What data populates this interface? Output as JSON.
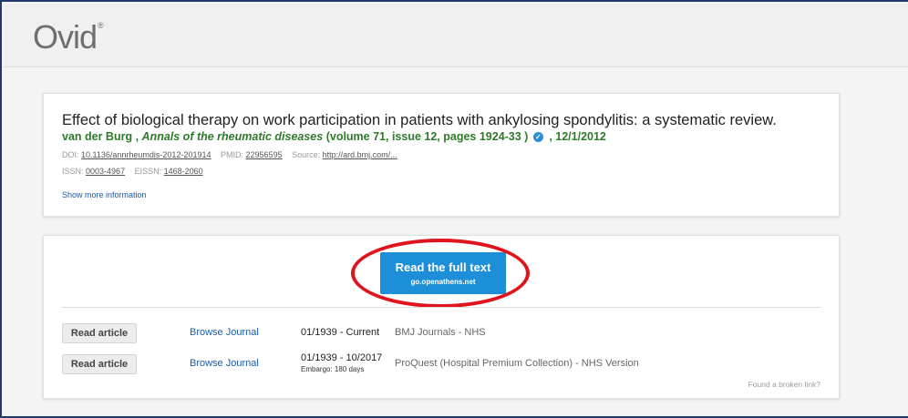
{
  "header": {
    "logo_text": "Ovid",
    "logo_mark": "®"
  },
  "article": {
    "title": "Effect of biological therapy on work participation in patients with ankylosing spondylitis: a systematic review.",
    "authors": "van der Burg ,",
    "journal": "Annals of the rheumatic diseases",
    "volume_info": "(volume 71, issue 12, pages 1924-33 )",
    "date": ", 12/1/2012",
    "doi_label": "DOI:",
    "doi": "10.1136/annrheumdis-2012-201914",
    "pmid_label": "PMID:",
    "pmid": "22956595",
    "source_label": "Source:",
    "source_url": "http://ard.bmj.com/...",
    "issn_label": "ISSN:",
    "issn": "0003-4967",
    "eissn_label": "EISSN:",
    "eissn": "1468-2060",
    "show_more": "Show more information"
  },
  "fulltext": {
    "button_label": "Read the full text",
    "button_sub": "go.openathens.net"
  },
  "links": [
    {
      "read_label": "Read article",
      "browse_label": "Browse Journal",
      "range": "01/1939 - Current",
      "embargo": "",
      "source": "BMJ Journals - NHS"
    },
    {
      "read_label": "Read article",
      "browse_label": "Browse Journal",
      "range": "01/1939 - 10/2017",
      "embargo": "Embargo: 180 days",
      "source": "ProQuest (Hospital Premium Collection) - NHS Version"
    }
  ],
  "broken_link": "Found a broken link?",
  "colors": {
    "button_blue": "#1d8fd9",
    "highlight_ring": "#e0141e",
    "byline_green": "#2e7a2a",
    "link_blue": "#1a5aa6"
  },
  "icons": {
    "verified": "verified-check-icon"
  }
}
